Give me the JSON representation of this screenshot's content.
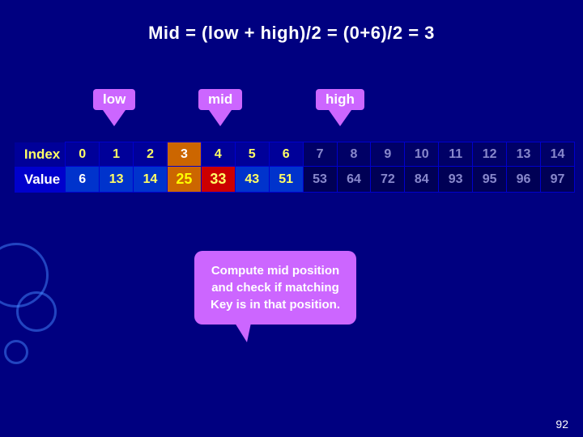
{
  "title": "Mid = (low + high)/2 = (0+6)/2 = 3",
  "labels": {
    "low": "low",
    "mid": "mid",
    "high": "high"
  },
  "table": {
    "index_label": "Index",
    "value_label": "Value",
    "index_values": [
      "0",
      "1",
      "2",
      "3",
      "4",
      "5",
      "6",
      "7",
      "8",
      "9",
      "10",
      "11",
      "12",
      "13",
      "14"
    ],
    "value_values": [
      "6",
      "13",
      "14",
      "25",
      "33",
      "43",
      "51",
      "53",
      "64",
      "72",
      "84",
      "93",
      "95",
      "96",
      "97"
    ]
  },
  "callout": "Compute mid position and check if matching Key is in that position.",
  "page_number": "92",
  "low_index": 0,
  "mid_index": 3,
  "high_index": 6
}
